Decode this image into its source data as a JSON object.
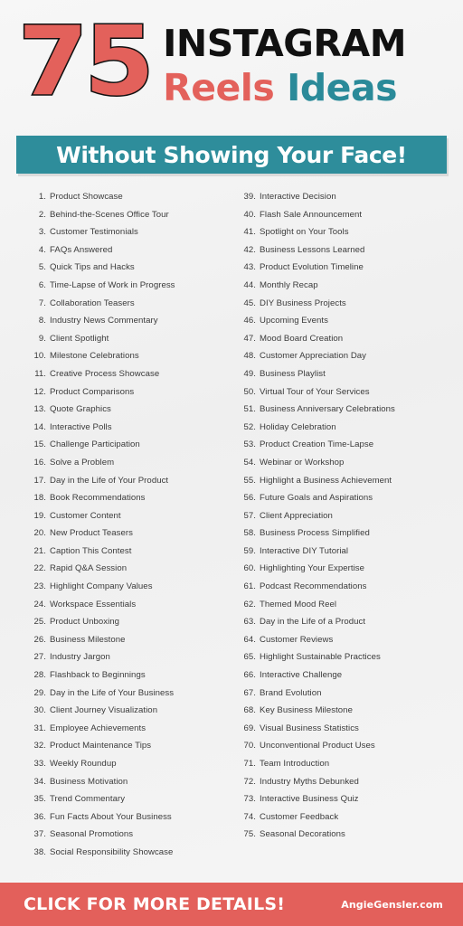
{
  "header": {
    "big_number": "75",
    "line1": "INSTAGRAM",
    "line2_part1": "Reels",
    "line2_part2": "Ideas",
    "banner": "Without Showing Your Face!"
  },
  "colors": {
    "red": "#e3605b",
    "teal": "#2e8d9b",
    "black": "#111111",
    "background": "#f2f2f2",
    "list_text": "#3b3b3b"
  },
  "list": {
    "left_column": [
      {
        "num": "1.",
        "label": "Product Showcase"
      },
      {
        "num": "2.",
        "label": "Behind-the-Scenes Office Tour"
      },
      {
        "num": "3.",
        "label": "Customer Testimonials"
      },
      {
        "num": "4.",
        "label": "FAQs Answered"
      },
      {
        "num": "5.",
        "label": "Quick Tips and Hacks"
      },
      {
        "num": "6.",
        "label": "Time-Lapse of Work in Progress"
      },
      {
        "num": "7.",
        "label": "Collaboration Teasers"
      },
      {
        "num": "8.",
        "label": "Industry News Commentary"
      },
      {
        "num": "9.",
        "label": "Client Spotlight"
      },
      {
        "num": "10.",
        "label": "Milestone Celebrations"
      },
      {
        "num": "11.",
        "label": "Creative Process Showcase"
      },
      {
        "num": "12.",
        "label": "Product Comparisons"
      },
      {
        "num": "13.",
        "label": "Quote Graphics"
      },
      {
        "num": "14.",
        "label": "Interactive Polls"
      },
      {
        "num": "15.",
        "label": "Challenge Participation"
      },
      {
        "num": "16.",
        "label": "Solve a Problem"
      },
      {
        "num": "17.",
        "label": "Day in the Life of Your Product"
      },
      {
        "num": "18.",
        "label": "Book Recommendations"
      },
      {
        "num": "19.",
        "label": "Customer Content"
      },
      {
        "num": "20.",
        "label": "New Product Teasers"
      },
      {
        "num": "21.",
        "label": "Caption This Contest"
      },
      {
        "num": "22.",
        "label": "Rapid Q&A Session"
      },
      {
        "num": "23.",
        "label": "Highlight Company Values"
      },
      {
        "num": "24.",
        "label": "Workspace Essentials"
      },
      {
        "num": "25.",
        "label": "Product Unboxing"
      },
      {
        "num": "26.",
        "label": "Business Milestone"
      },
      {
        "num": "27.",
        "label": "Industry Jargon"
      },
      {
        "num": "28.",
        "label": "Flashback to Beginnings"
      },
      {
        "num": "29.",
        "label": "Day in the Life of Your Business"
      },
      {
        "num": "30.",
        "label": "Client Journey Visualization"
      },
      {
        "num": "31.",
        "label": "Employee Achievements"
      },
      {
        "num": "32.",
        "label": "Product Maintenance Tips"
      },
      {
        "num": "33.",
        "label": "Weekly Roundup"
      },
      {
        "num": "34.",
        "label": "Business Motivation"
      },
      {
        "num": "35.",
        "label": "Trend Commentary"
      },
      {
        "num": "36.",
        "label": "Fun Facts About Your Business"
      },
      {
        "num": "37.",
        "label": "Seasonal Promotions"
      },
      {
        "num": "38.",
        "label": "Social Responsibility Showcase"
      }
    ],
    "right_column": [
      {
        "num": "39.",
        "label": "Interactive Decision"
      },
      {
        "num": "40.",
        "label": "Flash Sale Announcement"
      },
      {
        "num": "41.",
        "label": "Spotlight on Your Tools"
      },
      {
        "num": "42.",
        "label": "Business Lessons Learned"
      },
      {
        "num": "43.",
        "label": "Product Evolution Timeline"
      },
      {
        "num": "44.",
        "label": "Monthly Recap"
      },
      {
        "num": "45.",
        "label": "DIY Business Projects"
      },
      {
        "num": "46.",
        "label": "Upcoming Events"
      },
      {
        "num": "47.",
        "label": "Mood Board Creation"
      },
      {
        "num": "48.",
        "label": "Customer Appreciation Day"
      },
      {
        "num": "49.",
        "label": "Business Playlist"
      },
      {
        "num": "50.",
        "label": "Virtual Tour of Your Services"
      },
      {
        "num": "51.",
        "label": "Business Anniversary Celebrations"
      },
      {
        "num": "52.",
        "label": "Holiday Celebration"
      },
      {
        "num": "53.",
        "label": "Product Creation Time-Lapse"
      },
      {
        "num": "54.",
        "label": "Webinar or Workshop"
      },
      {
        "num": "55.",
        "label": "Highlight a Business Achievement"
      },
      {
        "num": "56.",
        "label": "Future Goals and Aspirations"
      },
      {
        "num": "57.",
        "label": "Client Appreciation"
      },
      {
        "num": "58.",
        "label": "Business Process Simplified"
      },
      {
        "num": "59.",
        "label": "Interactive DIY Tutorial"
      },
      {
        "num": "60.",
        "label": "Highlighting Your Expertise"
      },
      {
        "num": "61.",
        "label": "Podcast Recommendations"
      },
      {
        "num": "62.",
        "label": "Themed Mood Reel"
      },
      {
        "num": "63.",
        "label": "Day in the Life of a Product"
      },
      {
        "num": "64.",
        "label": "Customer Reviews"
      },
      {
        "num": "65.",
        "label": "Highlight Sustainable Practices"
      },
      {
        "num": "66.",
        "label": "Interactive Challenge"
      },
      {
        "num": "67.",
        "label": "Brand Evolution"
      },
      {
        "num": "68.",
        "label": "Key Business Milestone"
      },
      {
        "num": "69.",
        "label": "Visual Business Statistics"
      },
      {
        "num": "70.",
        "label": "Unconventional Product Uses"
      },
      {
        "num": "71.",
        "label": "Team Introduction"
      },
      {
        "num": "72.",
        "label": "Industry Myths Debunked"
      },
      {
        "num": "73.",
        "label": "Interactive Business Quiz"
      },
      {
        "num": "74.",
        "label": "Customer Feedback"
      },
      {
        "num": "75.",
        "label": "Seasonal Decorations"
      }
    ]
  },
  "footer": {
    "cta": "CLICK FOR MORE DETAILS!",
    "brand": "AngieGensler.com"
  }
}
